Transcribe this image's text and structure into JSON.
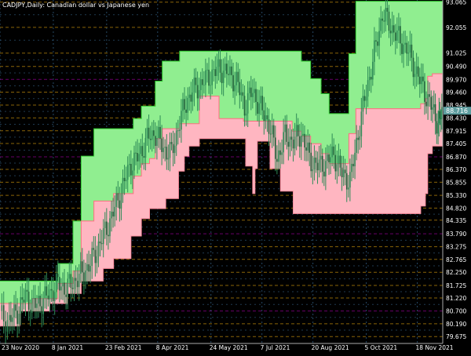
{
  "chart_data": {
    "type": "line",
    "title": "CADJPY,Daily:  Canadian dollar vs Japanese yen",
    "price_axis": {
      "labels": [
        "93.065",
        "92.055",
        "91.025",
        "90.490",
        "89.970",
        "89.460",
        "88.945",
        "88.430",
        "87.915",
        "87.405",
        "86.870",
        "86.370",
        "85.855",
        "85.330",
        "84.820",
        "84.335",
        "83.790",
        "83.275",
        "82.765",
        "82.250",
        "81.725",
        "81.220",
        "80.700",
        "80.190",
        "79.675"
      ],
      "ylim": [
        79.4,
        93.15
      ],
      "current_price": "88.716"
    },
    "time_axis": {
      "labels": [
        "23 Nov 2020",
        "8 Jan 2021",
        "23 Feb 2021",
        "8 Apr 2021",
        "24 May 2021",
        "7 Jul 2021",
        "20 Aug 2021",
        "5 Oct 2021",
        "18 Nov 2021"
      ],
      "range": [
        "2020-11-23",
        "2021-12-10"
      ]
    },
    "series": [
      {
        "type": "step",
        "points": [
          [
            "2020-11-23",
            80.1
          ],
          [
            "2020-12-10",
            80.7
          ],
          [
            "2021-01-05",
            81.0
          ],
          [
            "2021-01-20",
            81.4
          ],
          [
            "2021-02-01",
            81.9
          ],
          [
            "2021-02-20",
            82.4
          ],
          [
            "2021-03-01",
            82.8
          ],
          [
            "2021-03-16",
            83.7
          ],
          [
            "2021-03-25",
            84.4
          ],
          [
            "2021-04-01",
            84.8
          ],
          [
            "2021-04-15",
            85.2
          ],
          [
            "2021-04-26",
            86.3
          ],
          [
            "2021-05-01",
            86.9
          ],
          [
            "2021-05-05",
            87.3
          ],
          [
            "2021-05-14",
            87.6
          ],
          [
            "2021-06-23",
            86.5
          ],
          [
            "2021-06-29",
            85.4
          ],
          [
            "2021-07-01",
            86.4
          ],
          [
            "2021-07-03",
            87.5
          ],
          [
            "2021-07-14",
            86.4
          ],
          [
            "2021-07-23",
            85.5
          ],
          [
            "2021-08-03",
            84.6
          ],
          [
            "2021-08-24",
            84.6
          ],
          [
            "2021-09-10",
            84.6
          ],
          [
            "2021-10-05",
            84.6
          ],
          [
            "2021-10-25",
            84.6
          ],
          [
            "2021-11-10",
            84.6
          ],
          [
            "2021-11-21",
            84.9
          ],
          [
            "2021-11-25",
            85.4
          ],
          [
            "2021-11-27",
            87.0
          ],
          [
            "2021-12-01",
            87.3
          ],
          [
            "2021-12-10",
            87.3
          ]
        ]
      },
      {
        "type": "step",
        "points": [
          [
            "2020-11-23",
            81.9
          ],
          [
            "2020-12-21",
            81.9
          ],
          [
            "2021-01-12",
            82.6
          ],
          [
            "2021-01-25",
            84.3
          ],
          [
            "2021-02-01",
            86.9
          ],
          [
            "2021-02-12",
            88.0
          ],
          [
            "2021-03-01",
            88.0
          ],
          [
            "2021-03-18",
            88.4
          ],
          [
            "2021-03-25",
            88.9
          ],
          [
            "2021-04-01",
            88.9
          ],
          [
            "2021-04-06",
            89.9
          ],
          [
            "2021-04-12",
            90.7
          ],
          [
            "2021-04-27",
            91.1
          ],
          [
            "2021-05-31",
            91.1
          ],
          [
            "2021-06-21",
            91.1
          ],
          [
            "2021-07-06",
            91.1
          ],
          [
            "2021-07-19",
            91.1
          ],
          [
            "2021-08-02",
            91.1
          ],
          [
            "2021-08-10",
            90.7
          ],
          [
            "2021-08-18",
            90.0
          ],
          [
            "2021-08-27",
            89.4
          ],
          [
            "2021-09-03",
            88.6
          ],
          [
            "2021-09-16",
            88.6
          ],
          [
            "2021-09-20",
            91.0
          ],
          [
            "2021-09-26",
            93.1
          ],
          [
            "2021-10-05",
            93.1
          ],
          [
            "2021-10-25",
            93.1
          ],
          [
            "2021-11-10",
            93.1
          ],
          [
            "2021-11-25",
            93.1
          ],
          [
            "2021-12-10",
            93.1
          ]
        ]
      },
      {
        "type": "step",
        "points": [
          [
            "2020-11-23",
            81.0
          ],
          [
            "2020-12-21",
            81.2
          ],
          [
            "2021-01-12",
            81.8
          ],
          [
            "2021-01-25",
            82.3
          ],
          [
            "2021-02-01",
            84.3
          ],
          [
            "2021-02-12",
            85.1
          ],
          [
            "2021-03-01",
            85.4
          ],
          [
            "2021-03-18",
            86.1
          ],
          [
            "2021-03-25",
            86.6
          ],
          [
            "2021-04-01",
            86.8
          ],
          [
            "2021-04-06",
            87.6
          ],
          [
            "2021-04-12",
            88.0
          ],
          [
            "2021-04-27",
            88.2
          ],
          [
            "2021-05-14",
            89.3
          ],
          [
            "2021-05-31",
            88.4
          ],
          [
            "2021-06-21",
            88.3
          ],
          [
            "2021-07-06",
            88.3
          ],
          [
            "2021-07-19",
            88.3
          ],
          [
            "2021-08-02",
            87.9
          ],
          [
            "2021-08-10",
            87.7
          ],
          [
            "2021-08-18",
            87.4
          ],
          [
            "2021-08-27",
            87.0
          ],
          [
            "2021-09-03",
            86.6
          ],
          [
            "2021-09-16",
            86.6
          ],
          [
            "2021-09-20",
            87.8
          ],
          [
            "2021-09-26",
            88.8
          ],
          [
            "2021-10-05",
            88.8
          ],
          [
            "2021-10-25",
            88.8
          ],
          [
            "2021-11-10",
            88.8
          ],
          [
            "2021-11-21",
            89.0
          ],
          [
            "2021-11-25",
            89.2
          ],
          [
            "2021-11-27",
            90.1
          ],
          [
            "2021-12-01",
            90.2
          ],
          [
            "2021-12-10",
            90.2
          ]
        ]
      },
      {
        "type": "candlestick",
        "points": [
          [
            "2020-11-23",
            80.5
          ],
          [
            "2020-12-01",
            80.3
          ],
          [
            "2020-12-08",
            80.7
          ],
          [
            "2020-12-15",
            81.3
          ],
          [
            "2020-12-22",
            80.9
          ],
          [
            "2020-12-29",
            81.1
          ],
          [
            "2021-01-05",
            81.4
          ],
          [
            "2021-01-12",
            81.8
          ],
          [
            "2021-01-19",
            81.6
          ],
          [
            "2021-01-26",
            81.9
          ],
          [
            "2021-02-02",
            82.2
          ],
          [
            "2021-02-09",
            82.6
          ],
          [
            "2021-02-16",
            83.3
          ],
          [
            "2021-02-23",
            84.0
          ],
          [
            "2021-03-02",
            84.8
          ],
          [
            "2021-03-09",
            85.7
          ],
          [
            "2021-03-16",
            86.6
          ],
          [
            "2021-03-23",
            86.9
          ],
          [
            "2021-03-30",
            87.6
          ],
          [
            "2021-04-06",
            87.8
          ],
          [
            "2021-04-13",
            87.2
          ],
          [
            "2021-04-20",
            87.0
          ],
          [
            "2021-04-27",
            88.3
          ],
          [
            "2021-05-04",
            89.2
          ],
          [
            "2021-05-11",
            89.6
          ],
          [
            "2021-05-18",
            89.9
          ],
          [
            "2021-05-25",
            90.2
          ],
          [
            "2021-06-01",
            90.4
          ],
          [
            "2021-06-08",
            90.2
          ],
          [
            "2021-06-15",
            89.9
          ],
          [
            "2021-06-22",
            88.9
          ],
          [
            "2021-06-29",
            89.5
          ],
          [
            "2021-07-06",
            88.8
          ],
          [
            "2021-07-13",
            88.2
          ],
          [
            "2021-07-20",
            86.8
          ],
          [
            "2021-07-27",
            87.7
          ],
          [
            "2021-08-03",
            87.5
          ],
          [
            "2021-08-10",
            87.8
          ],
          [
            "2021-08-17",
            86.8
          ],
          [
            "2021-08-24",
            86.5
          ],
          [
            "2021-08-31",
            86.6
          ],
          [
            "2021-09-07",
            87.0
          ],
          [
            "2021-09-14",
            86.2
          ],
          [
            "2021-09-21",
            85.9
          ],
          [
            "2021-09-28",
            87.8
          ],
          [
            "2021-10-05",
            89.5
          ],
          [
            "2021-10-12",
            91.0
          ],
          [
            "2021-10-19",
            92.6
          ],
          [
            "2021-10-26",
            92.1
          ],
          [
            "2021-11-02",
            91.6
          ],
          [
            "2021-11-09",
            91.2
          ],
          [
            "2021-11-16",
            90.4
          ],
          [
            "2021-11-23",
            89.6
          ],
          [
            "2021-11-30",
            88.9
          ],
          [
            "2021-12-06",
            88.2
          ],
          [
            "2021-12-10",
            88.7
          ]
        ]
      }
    ],
    "grid": "dashed",
    "colors": {
      "background": "#000000",
      "band_upper": "#90ee90",
      "band_lower": "#ffb6c1",
      "price": "#2e8b57",
      "axis_text": "#ffffff",
      "grid_level": "#b8860b",
      "grid_alt": "#8b008b",
      "grid_mid": "#4682b4",
      "price_label": "#5f9ea0"
    }
  }
}
